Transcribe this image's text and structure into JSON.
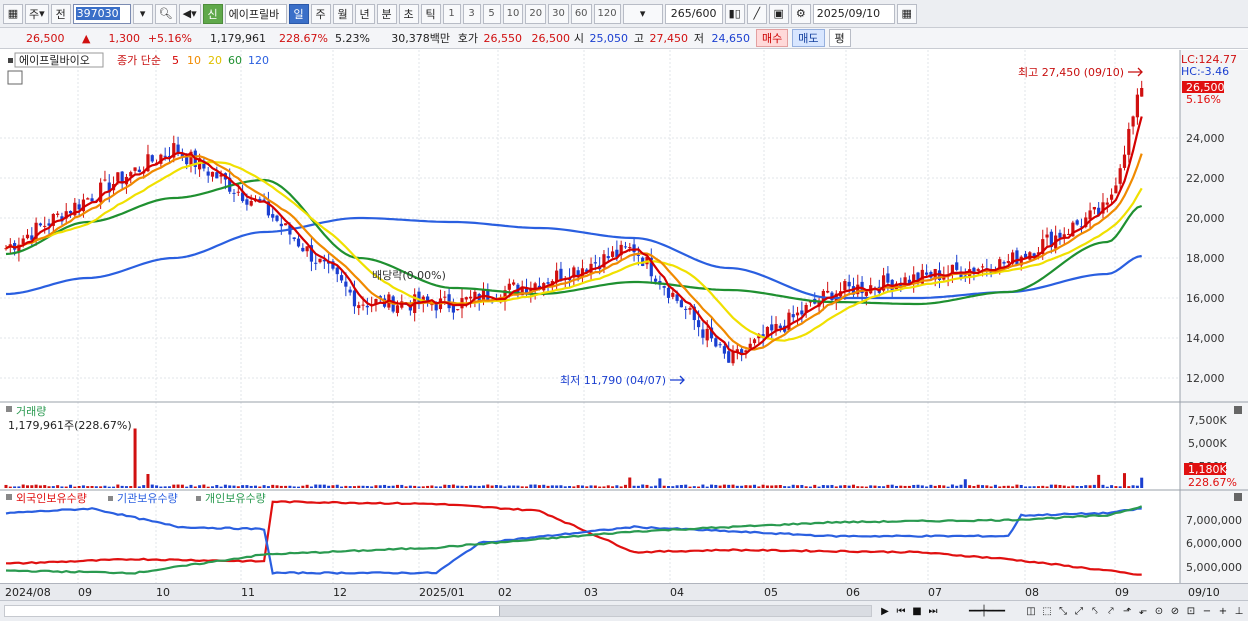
{
  "toolbar": {
    "period_type": "주",
    "prev_label": "전",
    "stock_code": "397030",
    "stock_name": "에이프릴바",
    "sin_label": "신",
    "periods": [
      "일",
      "주",
      "월",
      "년",
      "분",
      "초",
      "틱"
    ],
    "active_period": "일",
    "intervals": [
      "1",
      "3",
      "5",
      "10",
      "20",
      "30",
      "60",
      "120"
    ],
    "data_count": "265",
    "data_total": "/600",
    "date": "2025/09/10"
  },
  "quote": {
    "price": "26,500",
    "change": "1,300",
    "change_pct": "+5.16%",
    "volume": "1,179,961",
    "volume_ratio": "228.67%",
    "turnover": "5.23%",
    "amount": "30,378백만",
    "ask_label": "호가",
    "ask": "26,550",
    "bid": "26,500",
    "open_label": "시",
    "open": "25,050",
    "high_label": "고",
    "high": "27,450",
    "low_label": "저",
    "low": "24,650",
    "buy_label": "매수",
    "sell_label": "매도",
    "eval_label": "평"
  },
  "price_panel": {
    "stock_label": "에이프릴바이오",
    "ma_label": "종가 단순",
    "ma_periods": [
      "5",
      "10",
      "20",
      "60",
      "120"
    ],
    "ma_colors": [
      "#d40000",
      "#f08a00",
      "#f0e000",
      "#1f9030",
      "#2a5fe0"
    ],
    "lc_label": "LC:124.77",
    "hc_label": "HC:-3.46",
    "current_tag": "26,500",
    "pct_tag": "5.16%",
    "high_annotation": "최고 27,450 (09/10)",
    "low_annotation": "최저 11,790 (04/07)",
    "bb_annotation": "배당락(0.00%)",
    "y_ticks": [
      "24,000",
      "22,000",
      "20,000",
      "18,000",
      "16,000",
      "14,000",
      "12,000"
    ]
  },
  "volume_panel": {
    "title": "거래량",
    "value_label": "1,179,961주(228.67%)",
    "y_ticks": [
      "7,500K",
      "5,000K",
      "2,500K"
    ],
    "current_tag": "1,180K",
    "pct_tag": "228.67%"
  },
  "holding_panel": {
    "legends": [
      "외국인보유수량",
      "기관보유수량",
      "개인보유수량"
    ],
    "colors": [
      "#e01010",
      "#2a5fe0",
      "#2a9a50"
    ],
    "y_ticks": [
      "7,000,000",
      "6,000,000",
      "5,000,000"
    ]
  },
  "x_labels": [
    "2024/08",
    "09",
    "10",
    "11",
    "12",
    "2025/01",
    "02",
    "03",
    "04",
    "05",
    "06",
    "07",
    "08",
    "09"
  ],
  "x_right_label": "09/10",
  "chart_data": [
    {
      "type": "line",
      "title": "",
      "x": [
        "2024/08",
        "09",
        "10",
        "11",
        "12",
        "2025/01",
        "02",
        "03",
        "04",
        "05",
        "06",
        "07",
        "08",
        "09"
      ],
      "series": [
        {
          "name": "종가",
          "values": [
            18500,
            21000,
            23500,
            20500,
            15800,
            15700,
            16800,
            18500,
            12800,
            16300,
            17000,
            17800,
            20500,
            26500
          ]
        },
        {
          "name": "120",
          "values": [
            16200,
            17000,
            18000,
            19300,
            20000,
            19800,
            19500,
            19000,
            17500,
            16000,
            16000,
            16300,
            17200,
            18100
          ]
        },
        {
          "name": "60",
          "values": [
            18200,
            19800,
            21000,
            21900,
            18000,
            16500,
            16200,
            16800,
            16400,
            15800,
            15700,
            16300,
            18800,
            20600
          ]
        }
      ],
      "ylim": [
        11000,
        28000
      ]
    },
    {
      "type": "bar",
      "title": "거래량",
      "series": [
        {
          "name": "거래량",
          "values": [
            1179961
          ]
        }
      ],
      "ylim": [
        0,
        8000000
      ]
    }
  ]
}
